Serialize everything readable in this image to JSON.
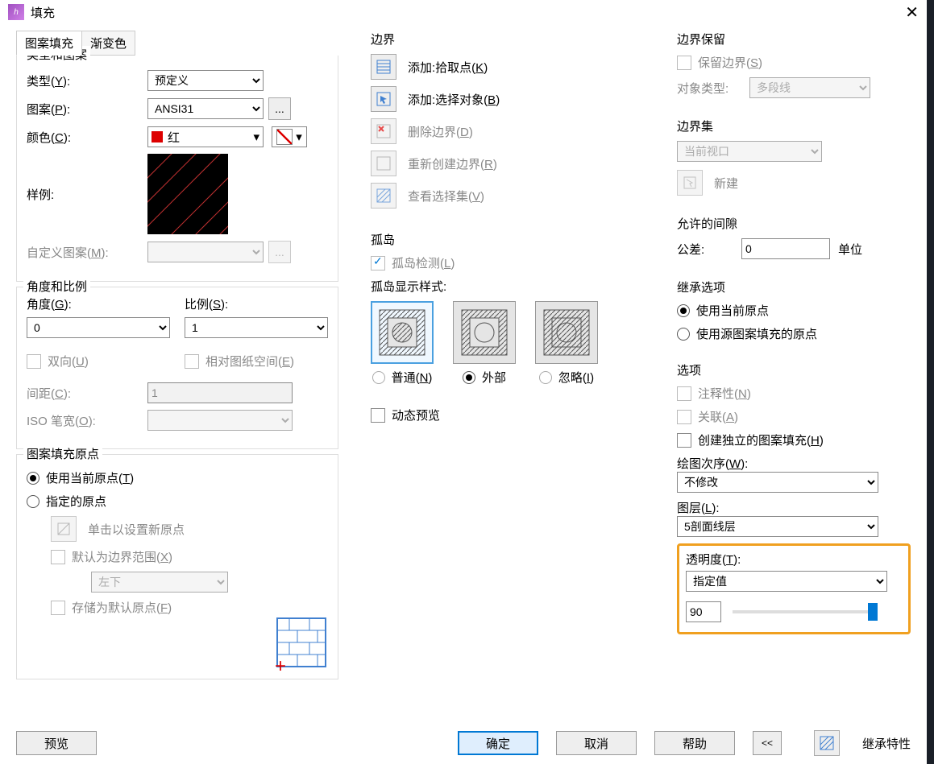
{
  "title": "填充",
  "tabs": {
    "pattern": "图案填充",
    "gradient": "渐变色"
  },
  "type_group": {
    "title": "类型和图案",
    "type_label": "类型(Y):",
    "type_value": "预定义",
    "pattern_label": "图案(P):",
    "pattern_value": "ANSI31",
    "color_label": "颜色(C):",
    "color_value": "红",
    "sample_label": "样例:",
    "custom_label": "自定义图案(M):"
  },
  "angle_group": {
    "title": "角度和比例",
    "angle_label": "角度(G):",
    "angle_value": "0",
    "scale_label": "比例(S):",
    "scale_value": "1",
    "dbl_label": "双向(U)",
    "relpaper_label": "相对图纸空间(E)",
    "spacing_label": "间距(C):",
    "spacing_value": "1",
    "iso_label": "ISO 笔宽(O):"
  },
  "origin_group": {
    "title": "图案填充原点",
    "use_current": "使用当前原点(T)",
    "specified": "指定的原点",
    "click_set": "单击以设置新原点",
    "default_ext": "默认为边界范围(X)",
    "pos_value": "左下",
    "store_default": "存储为默认原点(F)"
  },
  "boundary": {
    "title": "边界",
    "add_pick": "添加:拾取点(K)",
    "add_sel": "添加:选择对象(B)",
    "del": "删除边界(D)",
    "recreate": "重新创建边界(R)",
    "view_sel": "查看选择集(V)"
  },
  "island": {
    "title": "孤岛",
    "detect": "孤岛检测(L)",
    "style_label": "孤岛显示样式:",
    "normal": "普通(N)",
    "outer": "外部",
    "ignore": "忽略(I)"
  },
  "dyn_preview": "动态预览",
  "bretain": {
    "title": "边界保留",
    "keep": "保留边界(S)",
    "objtype_label": "对象类型:",
    "objtype_value": "多段线"
  },
  "bset": {
    "title": "边界集",
    "value": "当前视口",
    "new": "新建"
  },
  "gap": {
    "title": "允许的间隙",
    "tol_label": "公差:",
    "tol_value": "0",
    "unit": "单位"
  },
  "inherit_opt": {
    "title": "继承选项",
    "use_current": "使用当前原点",
    "use_source": "使用源图案填充的原点"
  },
  "options": {
    "title": "选项",
    "annotative": "注释性(N)",
    "assoc": "关联(A)",
    "create_sep": "创建独立的图案填充(H)",
    "draw_order_label": "绘图次序(W):",
    "draw_order_value": "不修改",
    "layer_label": "图层(L):",
    "layer_value": "5剖面线层",
    "trans_label": "透明度(T):",
    "trans_mode": "指定值",
    "trans_value": "90"
  },
  "inherit_props": "继承特性",
  "footer": {
    "preview": "预览",
    "ok": "确定",
    "cancel": "取消",
    "help": "帮助"
  }
}
